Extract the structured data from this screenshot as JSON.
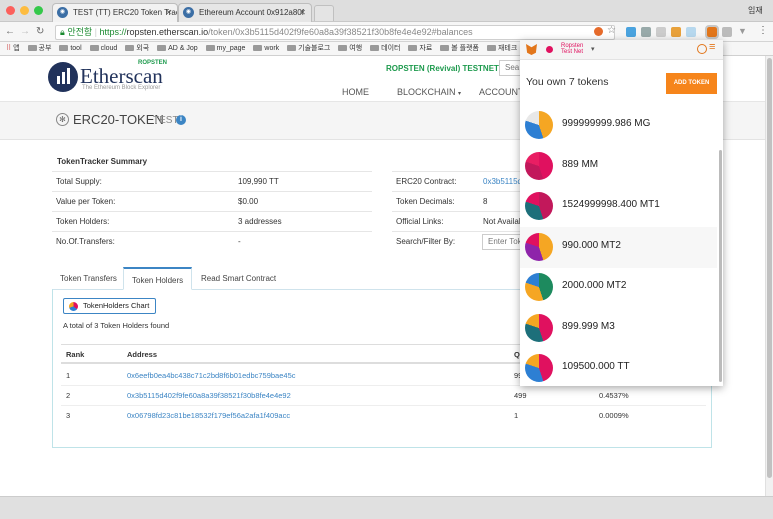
{
  "browser": {
    "tabs": [
      {
        "icon": "etherscan-icon",
        "label": "TEST (TT) ERC20 Token Track"
      },
      {
        "icon": "etherscan-icon",
        "label": "Ethereum Account 0x912a80f"
      }
    ],
    "profile": "임재",
    "url": {
      "secure_label": "안전함",
      "scheme": "https://",
      "host": "ropsten.etherscan.io",
      "path": "/token/0x3b5115d402f9fe60a8a39f38521f30b8fe4e4e92#balances"
    },
    "bookmarks": [
      "앱",
      "공부",
      "tool",
      "cloud",
      "외국",
      "AD & Jop",
      "my_page",
      "work",
      "기술블로그",
      "여행",
      "데이터",
      "자료",
      "볼 플랫폼",
      "재테크"
    ]
  },
  "site": {
    "logo_network": "ROPSTEN",
    "logo_name": "Etherscan",
    "logo_tagline": "The Ethereum Block Explorer",
    "network_label": "ROPSTEN (Revival) TESTNET",
    "search_placeholder": "Sea",
    "nav": [
      "HOME",
      "BLOCKCHAIN",
      "ACCOUNT"
    ],
    "page_title": "ERC20-TOKEN",
    "page_subtitle": "TEST"
  },
  "summary": {
    "heading": "TokenTracker Summary",
    "left": [
      {
        "label": "Total Supply:",
        "value": "109,990 TT"
      },
      {
        "label": "Value per Token:",
        "value": "$0.00"
      },
      {
        "label": "Token Holders:",
        "value": "3 addresses"
      },
      {
        "label": "No.Of.Transfers:",
        "value": "-"
      }
    ],
    "right": [
      {
        "label": "ERC20 Contract:",
        "value": "0x3b5115d"
      },
      {
        "label": "Token Decimals:",
        "value": "8"
      },
      {
        "label": "Official Links:",
        "value": "Not Availab"
      },
      {
        "label": "Search/Filter By:",
        "value": "Enter Tok"
      }
    ]
  },
  "tabs": [
    "Token Transfers",
    "Token Holders",
    "Read Smart Contract"
  ],
  "holders": {
    "chart_button": "TokenHolders Chart",
    "count_text": "A total of 3 Token Holders found",
    "columns": [
      "Rank",
      "Address",
      "Q"
    ],
    "rows": [
      {
        "rank": "1",
        "address": "0x6eefb0ea4bc438c71c2bd8f6b01edbc759bae45c",
        "quantity": "99",
        "pct": ""
      },
      {
        "rank": "2",
        "address": "0x3b5115d402f9fe60a8a39f38521f30b8fe4e4e92",
        "quantity": "499",
        "pct": "0.4537%"
      },
      {
        "rank": "3",
        "address": "0x06798fd23c81be18532f179ef56a2afa1f409acc",
        "quantity": "1",
        "pct": "0.0009%"
      }
    ]
  },
  "metamask": {
    "network_line1": "Ropsten",
    "network_line2": "Test Net",
    "heading": "You own 7 tokens",
    "add_button": "ADD TOKEN",
    "tokens": [
      {
        "amount": "999999999.986 MG",
        "colors": [
          "#f5a623",
          "#2d7fd3",
          "#e8e8e8"
        ]
      },
      {
        "amount": "889 MM",
        "colors": [
          "#e0115f",
          "#c2185b",
          "#e91e63"
        ]
      },
      {
        "amount": "1524999998.400 MT1",
        "colors": [
          "#c2185b",
          "#1d6f7a",
          "#e0115f"
        ]
      },
      {
        "amount": "990.000 MT2",
        "colors": [
          "#f5a623",
          "#8e24aa",
          "#e0115f"
        ]
      },
      {
        "amount": "2000.000 MT2",
        "colors": [
          "#1d8a5e",
          "#f5a623",
          "#2d7fd3"
        ]
      },
      {
        "amount": "899.999 M3",
        "colors": [
          "#e0115f",
          "#1d6f7a",
          "#f5a623"
        ]
      },
      {
        "amount": "109500.000 TT",
        "colors": [
          "#e0115f",
          "#2d7fd3",
          "#f5a623"
        ]
      }
    ]
  }
}
